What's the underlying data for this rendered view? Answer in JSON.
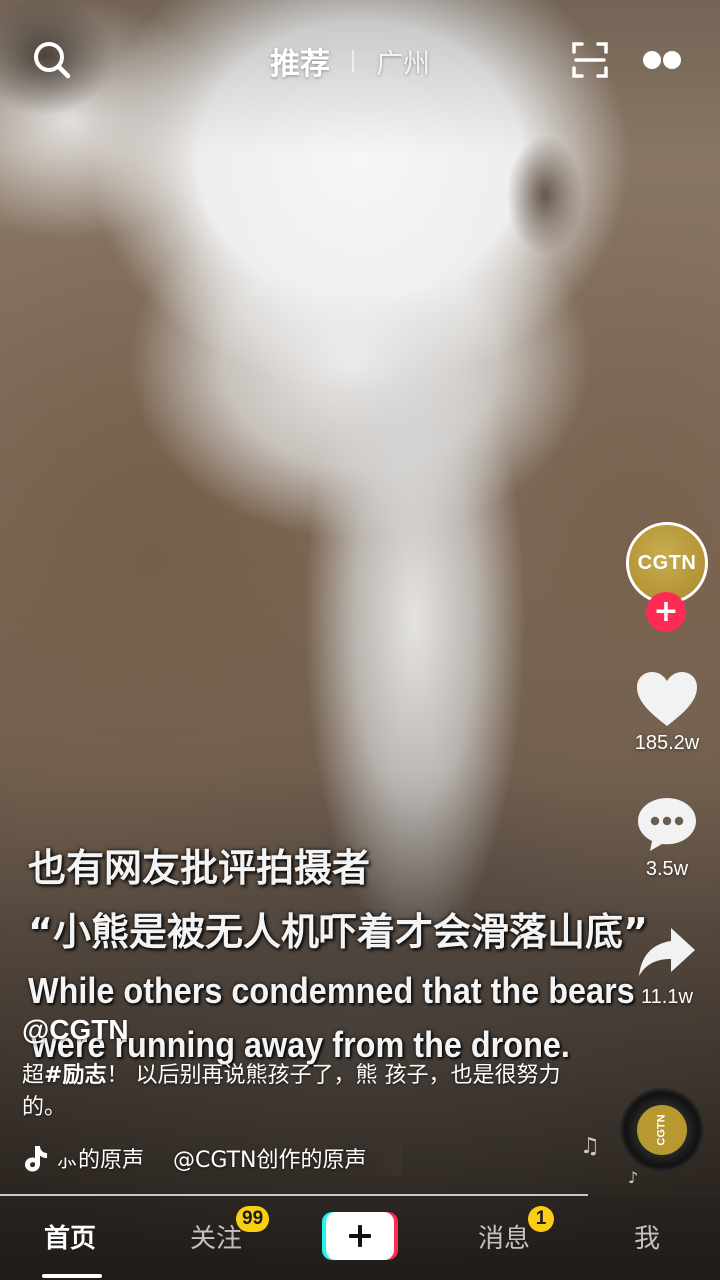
{
  "topbar": {
    "tab_recommend": "推荐",
    "tab_city": "广州",
    "icons": [
      "search-icon",
      "scan-icon",
      "more-icon"
    ]
  },
  "rail": {
    "avatar_text": "CGTN",
    "follow_symbol": "+",
    "likes": "185.2w",
    "comments": "3.5w",
    "shares": "11.1w",
    "icons": [
      "heart-icon",
      "comment-icon",
      "share-icon"
    ]
  },
  "subtitles": {
    "line1": "也有网友批评拍摄者",
    "line2": "“小熊是被无人机吓着才会滑落山底”",
    "line3": "While others condemned that the bears",
    "line4": "were running away from the drone."
  },
  "caption": {
    "author": "@CGTN",
    "desc_prefix": "超",
    "desc_tag": "#励志",
    "desc_rest": "！ 以后别再说熊孩子了，熊 孩子，也是很努力的。"
  },
  "music": {
    "text": "⺗的原声　 @CGTN创作的原声",
    "disc_text": "CGTN",
    "notes": [
      "♫",
      "♪"
    ]
  },
  "nav": {
    "home": "首页",
    "follow": "关注",
    "follow_badge": "99",
    "messages": "消息",
    "messages_badge": "1",
    "me": "我",
    "create_symbol": "+"
  },
  "colors": {
    "accent_red": "#fe2c55",
    "accent_cyan": "#25f4ee",
    "badge_yellow": "#face15",
    "cgtn_gold": "#b8992f"
  }
}
